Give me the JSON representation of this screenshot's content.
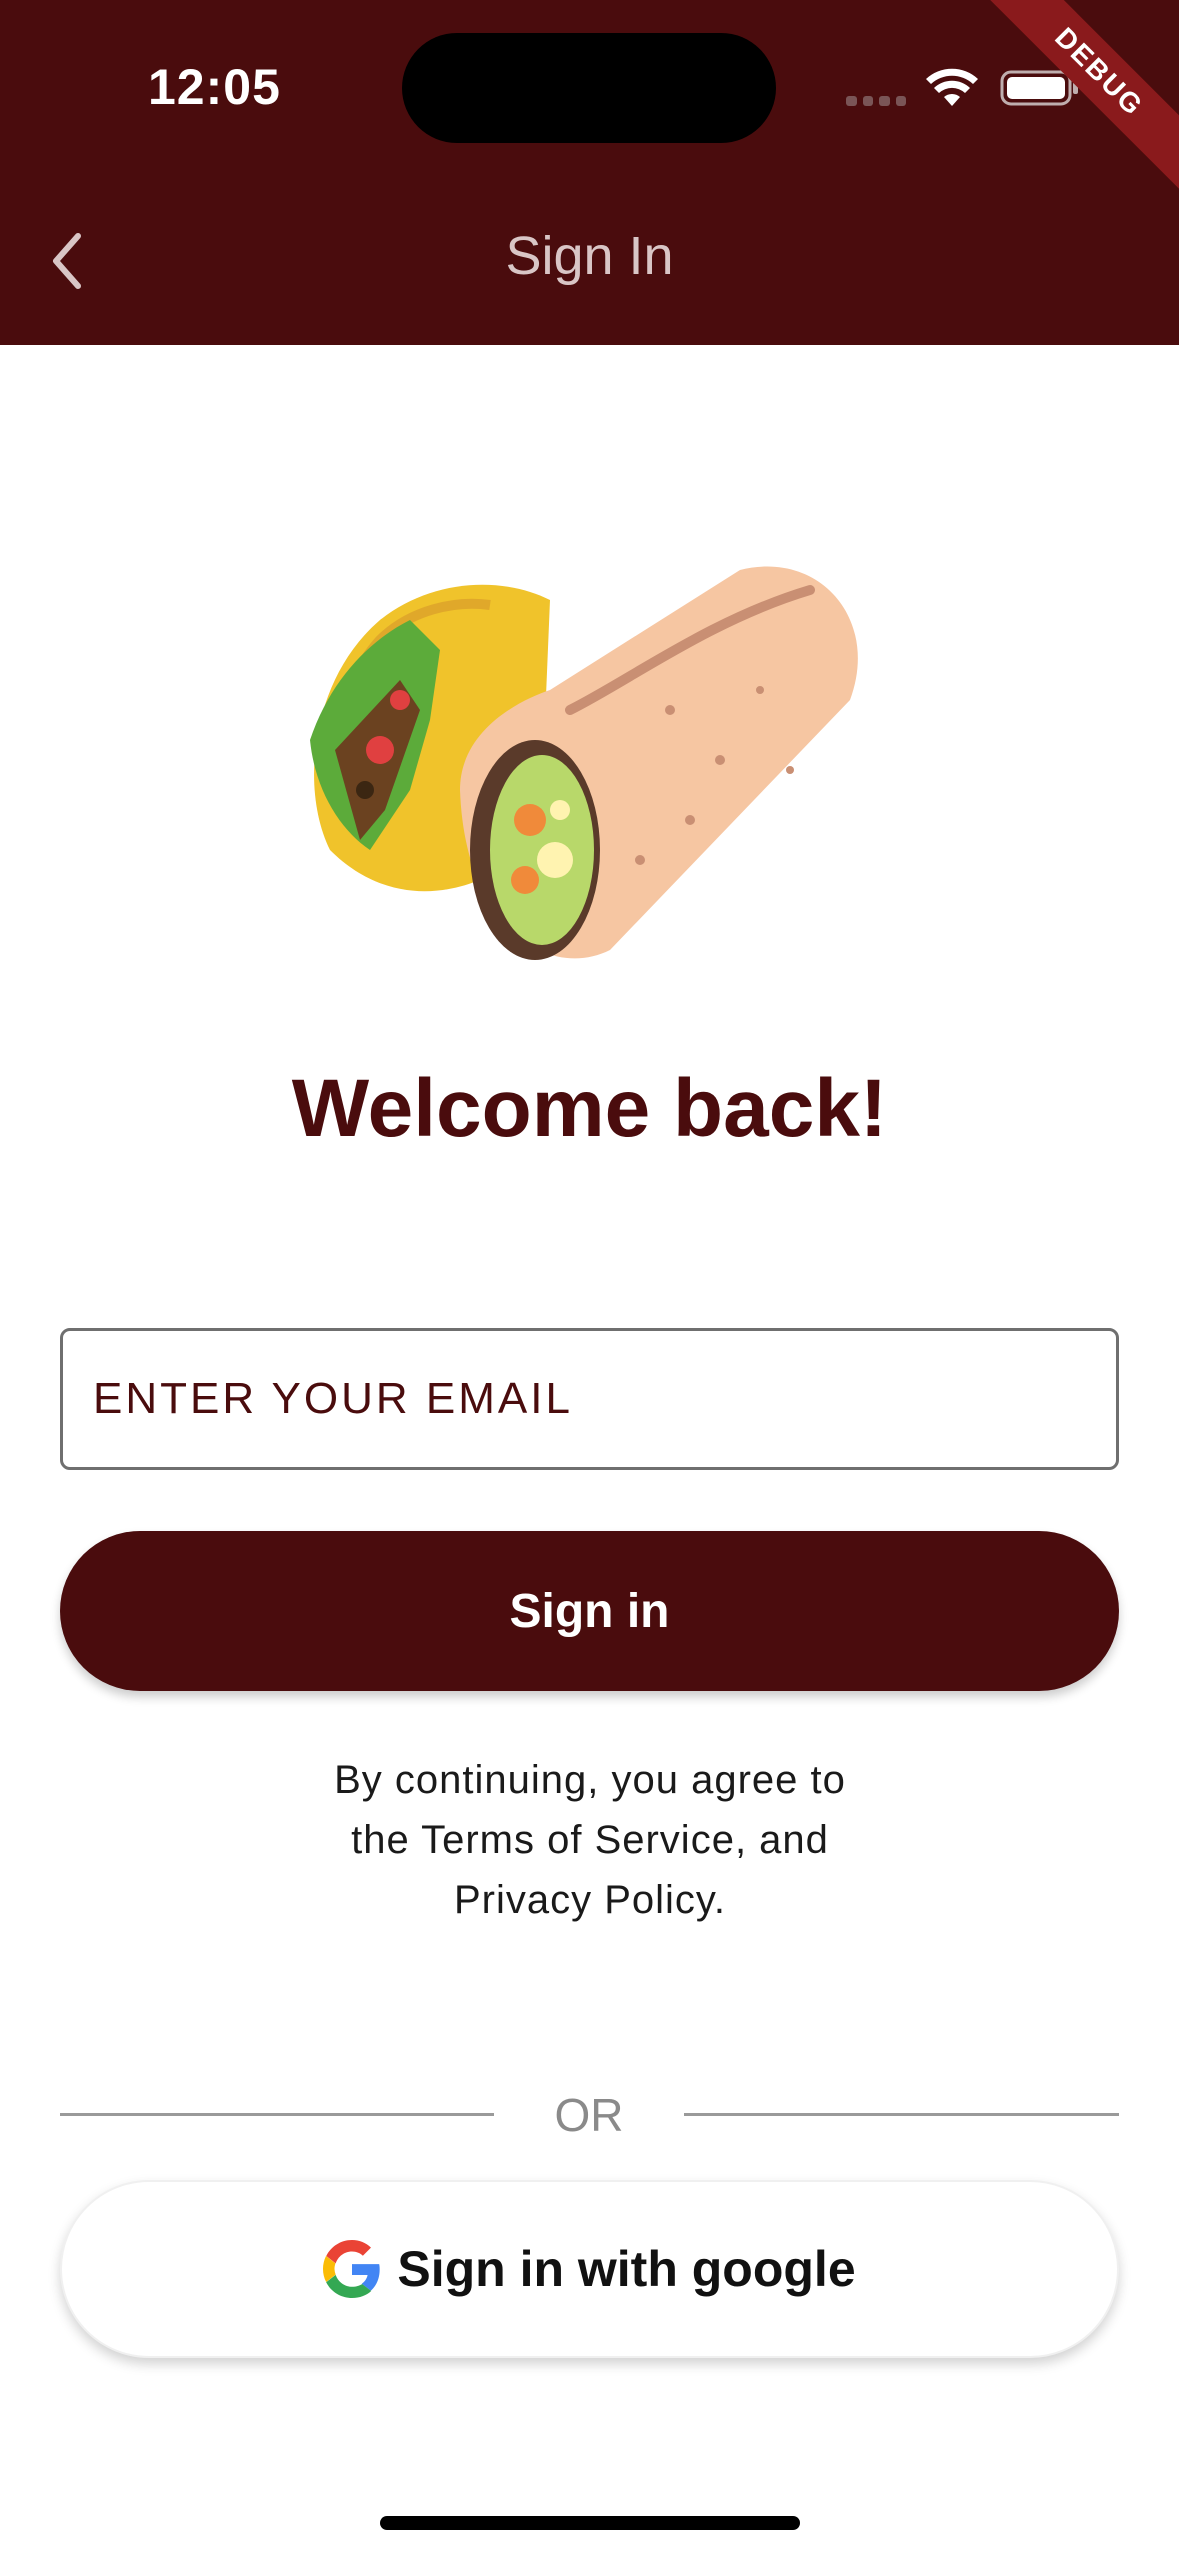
{
  "status_bar": {
    "time": "12:05",
    "debug_label": "DEBUG"
  },
  "nav": {
    "title": "Sign In",
    "back_icon": "chevron-left-icon"
  },
  "welcome": {
    "heading": "Welcome back!",
    "illustration": "taco-burrito-illustration"
  },
  "form": {
    "email_placeholder": "ENTER YOUR EMAIL",
    "email_value": "",
    "signin_label": "Sign in"
  },
  "terms": {
    "line1": "By continuing, you agree to",
    "line2": "the Terms of Service, and",
    "line3": "Privacy Policy."
  },
  "divider": {
    "label": "OR"
  },
  "google": {
    "label": "Sign in with google",
    "icon": "google-icon"
  },
  "colors": {
    "primary": "#4a0c0d",
    "nav_title": "#d9c6c6",
    "debug_ribbon": "#8a1a1c"
  }
}
